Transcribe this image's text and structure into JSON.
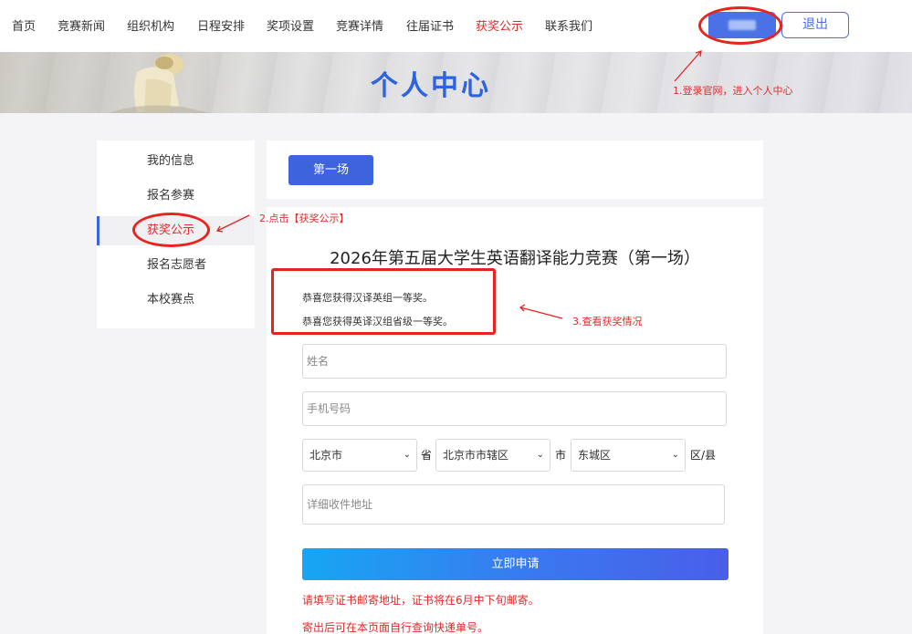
{
  "nav": {
    "items": [
      "首页",
      "竞赛新闻",
      "组织机构",
      "日程安排",
      "奖项设置",
      "竞赛详情",
      "往届证书",
      "获奖公示",
      "联系我们"
    ],
    "active": "获奖公示",
    "logout_label": "退出"
  },
  "banner": {
    "title": "个人中心"
  },
  "sidebar": {
    "items": [
      "我的信息",
      "报名参赛",
      "获奖公示",
      "报名志愿者",
      "本校赛点"
    ],
    "active": "获奖公示"
  },
  "tabs": {
    "first_label": "第一场"
  },
  "main": {
    "title": "2026年第五届大学生英语翻译能力竞赛（第一场）",
    "awards": [
      "恭喜您获得汉译英组一等奖。",
      "恭喜您获得英译汉组省级一等奖。"
    ],
    "form": {
      "name_placeholder": "姓名",
      "phone_placeholder": "手机号码",
      "province_value": "北京市",
      "province_unit": "省",
      "city_value": "北京市市辖区",
      "city_unit": "市",
      "district_value": "东城区",
      "district_unit": "区/县",
      "address_placeholder": "详细收件地址",
      "submit_label": "立即申请"
    },
    "notices": [
      "请填写证书邮寄地址，证书将在6月中下旬邮寄。",
      "寄出后可在本页面自行查询快递单号。"
    ]
  },
  "annotations": {
    "step1": "1.登录官网，进入个人中心",
    "step2": "2.点击【获奖公示】",
    "step3": "3.查看获奖情况"
  },
  "colors": {
    "accent": "#3d63dd",
    "active_red": "#e22b2b",
    "annotation_red": "#e8231e"
  }
}
